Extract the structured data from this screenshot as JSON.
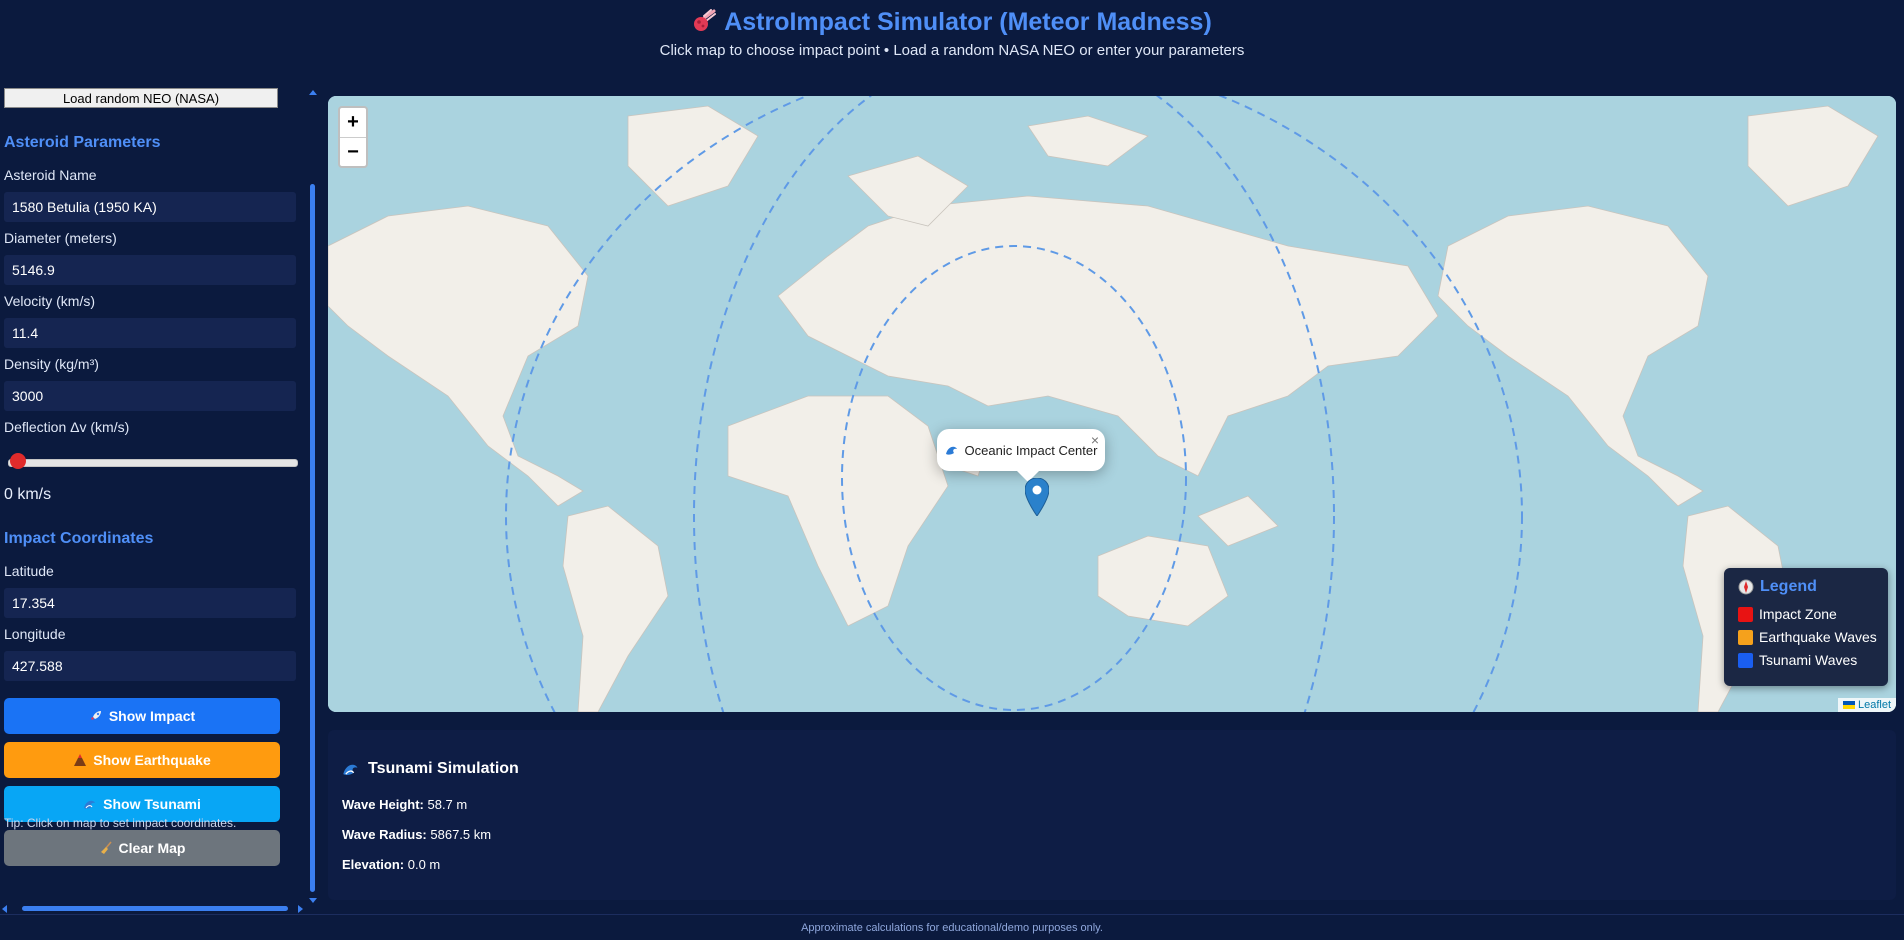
{
  "header": {
    "title": "AstroImpact Simulator (Meteor Madness)",
    "subtitle": "Click map to choose impact point • Load a random NASA NEO or enter your parameters"
  },
  "sidebar": {
    "load_neo_label": "Load random NEO (NASA)",
    "asteroid_section_title": "Asteroid Parameters",
    "name_label": "Asteroid Name",
    "name_value": "1580 Betulia (1950 KA)",
    "diameter_label": "Diameter (meters)",
    "diameter_value": "5146.9",
    "velocity_label": "Velocity (km/s)",
    "velocity_value": "11.4",
    "density_label": "Density (kg/m³)",
    "density_value": "3000",
    "deflection_label": "Deflection Δv (km/s)",
    "deflection_value": 0,
    "deflection_display": "0 km/s",
    "coords_section_title": "Impact Coordinates",
    "lat_label": "Latitude",
    "lat_value": "17.354",
    "lon_label": "Longitude",
    "lon_value": "427.588",
    "buttons": {
      "impact": "Show Impact",
      "earthquake": "Show Earthquake",
      "tsunami": "Show Tsunami",
      "clear": "Clear Map"
    },
    "tip": "Tip: Click on map to set impact coordinates."
  },
  "map": {
    "zoom_in": "+",
    "zoom_out": "−",
    "popup_text": "Oceanic Impact Center",
    "popup_close": "×",
    "attribution": "Leaflet",
    "legend": {
      "title": "Legend",
      "items": [
        {
          "label": "Impact Zone",
          "color": "#e81313"
        },
        {
          "label": "Earthquake Waves",
          "color": "#f5a11c"
        },
        {
          "label": "Tsunami Waves",
          "color": "#1a5ef0"
        }
      ]
    }
  },
  "results": {
    "title": "Tsunami Simulation",
    "wave_height_label": "Wave Height:",
    "wave_height_value": "58.7 m",
    "wave_radius_label": "Wave Radius:",
    "wave_radius_value": "5867.5 km",
    "elevation_label": "Elevation:",
    "elevation_value": "0.0 m"
  },
  "footer": "Approximate calculations for educational/demo purposes only.",
  "colors": {
    "background": "#0b1a3e",
    "accent": "#4f8ff7",
    "impact_button": "#1a73f5",
    "earthquake_button": "#ff9b0f",
    "tsunami_button": "#08a6f5",
    "clear_button": "#6d757d"
  }
}
